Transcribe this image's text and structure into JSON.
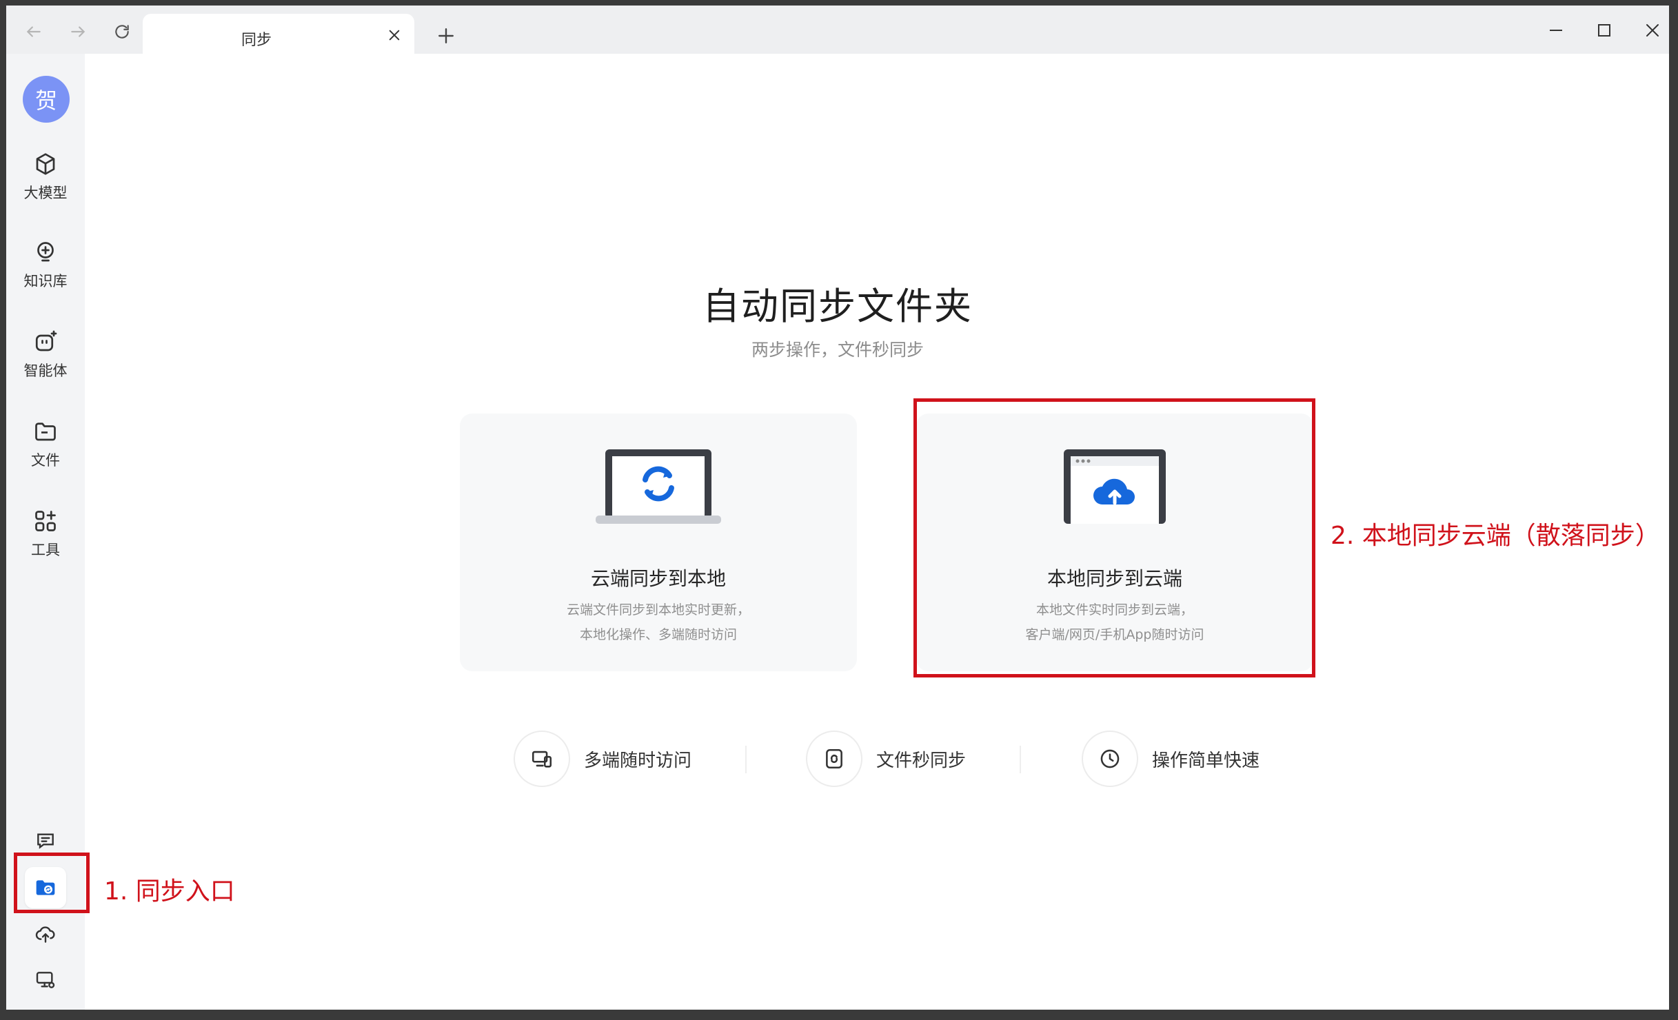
{
  "tab": {
    "title": "同步"
  },
  "sidebar": {
    "avatar": "贺",
    "items": [
      {
        "label": "大模型"
      },
      {
        "label": "知识库"
      },
      {
        "label": "智能体"
      },
      {
        "label": "文件"
      },
      {
        "label": "工具"
      }
    ]
  },
  "main": {
    "title": "自动同步文件夹",
    "subtitle": "两步操作，文件秒同步",
    "cards": [
      {
        "title": "云端同步到本地",
        "desc1": "云端文件同步到本地实时更新，",
        "desc2": "本地化操作、多端随时访问"
      },
      {
        "title": "本地同步到云端",
        "desc1": "本地文件实时同步到云端，",
        "desc2": "客户端/网页/手机App随时访问"
      }
    ],
    "features": [
      {
        "label": "多端随时访问"
      },
      {
        "label": "文件秒同步"
      },
      {
        "label": "操作简单快速"
      }
    ]
  },
  "annotations": {
    "step1": "1. 同步入口",
    "step2": "2. 本地同步云端（散落同步）"
  },
  "colors": {
    "accent": "#1668dc",
    "annotation": "#d0121b",
    "avatar": "#7b93f5"
  }
}
